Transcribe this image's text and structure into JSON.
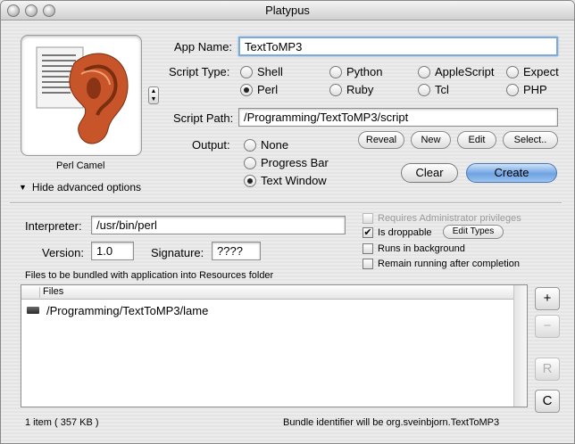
{
  "window": {
    "title": "Platypus"
  },
  "icon": {
    "caption": "Perl Camel",
    "art": "ear-icon"
  },
  "advanced_toggle": {
    "label": "Hide advanced options"
  },
  "app_name": {
    "label": "App Name:",
    "value": "TextToMP3"
  },
  "script_type": {
    "label": "Script Type:",
    "options": [
      {
        "label": "Shell",
        "selected": false
      },
      {
        "label": "Python",
        "selected": false
      },
      {
        "label": "AppleScript",
        "selected": false
      },
      {
        "label": "Expect",
        "selected": false
      },
      {
        "label": "Perl",
        "selected": true
      },
      {
        "label": "Ruby",
        "selected": false
      },
      {
        "label": "Tcl",
        "selected": false
      },
      {
        "label": "PHP",
        "selected": false
      }
    ]
  },
  "script_path": {
    "label": "Script Path:",
    "value": "/Programming/TextToMP3/script"
  },
  "script_buttons": {
    "reveal": "Reveal",
    "new": "New",
    "edit": "Edit",
    "select": "Select.."
  },
  "output": {
    "label": "Output:",
    "options": [
      {
        "label": "None",
        "selected": false
      },
      {
        "label": "Progress Bar",
        "selected": false
      },
      {
        "label": "Text Window",
        "selected": true
      }
    ]
  },
  "actions": {
    "clear": "Clear",
    "create": "Create"
  },
  "interpreter": {
    "label": "Interpreter:",
    "value": "/usr/bin/perl"
  },
  "version": {
    "label": "Version:",
    "value": "1.0"
  },
  "signature": {
    "label": "Signature:",
    "value": "????"
  },
  "options": {
    "requires_admin": {
      "label": "Requires Administrator privileges",
      "checked": false,
      "enabled": false
    },
    "droppable": {
      "label": "Is droppable",
      "checked": true,
      "edit_types": "Edit Types"
    },
    "background": {
      "label": "Runs in background",
      "checked": false
    },
    "remain_running": {
      "label": "Remain running after completion",
      "checked": false
    }
  },
  "bundle": {
    "heading": "Files to be bundled with application into Resources folder",
    "column": "Files",
    "files": [
      "/Programming/TextToMP3/lame"
    ],
    "side_buttons": {
      "add": "+",
      "remove": "−",
      "reveal": "R",
      "clear": "C"
    },
    "count": "1 item  ( 357 KB )",
    "identifier": "Bundle identifier will be org.sveinbjorn.TextToMP3"
  }
}
